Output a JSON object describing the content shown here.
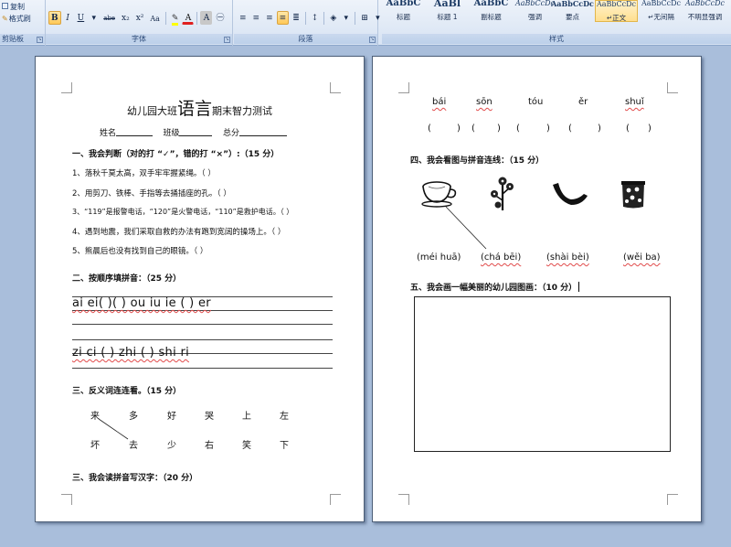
{
  "clipboard": {
    "copy": "复制",
    "format_painter": "格式刷",
    "label": "剪贴板"
  },
  "font": {
    "label": "字体",
    "buttons": [
      "B",
      "I",
      "U",
      "abe",
      "x₂",
      "x²",
      "Aa",
      "A",
      "A",
      "㊀"
    ]
  },
  "paragraph": {
    "label": "段落"
  },
  "styles": {
    "label": "样式",
    "items": [
      {
        "preview": "AaBbC",
        "name": "标题"
      },
      {
        "preview": "AaBl",
        "name": "标题 1"
      },
      {
        "preview": "AaBbC",
        "name": "副标题"
      },
      {
        "preview": "AaBbCcDc",
        "name": "强调"
      },
      {
        "preview": "AaBbCcDc",
        "name": "要点"
      },
      {
        "preview": "AaBbCcDc",
        "name": "正文"
      },
      {
        "preview": "AaBbCcDc",
        "name": "无间隔"
      },
      {
        "preview": "AaBbCcDc",
        "name": "不明显强调"
      }
    ],
    "selected": 5
  },
  "page1": {
    "title_pre": "幼儿园大班",
    "title_big": "语言",
    "title_post": "期末智力测试",
    "fields": [
      "姓名",
      "班级",
      "总分"
    ],
    "s1": {
      "heading": "一、我会判断（对的打 “✓”，错的打 “×”）:（15 分）",
      "items": [
        "1、落秋千莫太高，双手牢牢握紧绳。（     ）",
        "2、用剪刀、铁棒、手指等去捅插座的孔。（     ）",
        "3、“119”是报警电话，“120”是火警电话，“110”是救护电话。（     ）",
        "4、遇到地震，我们采取自救的办法有跑到宽阔的操场上。（     ）",
        "5、熊晨后也没有找到自己的眼镜。（     ）"
      ]
    },
    "s2": {
      "heading": "二、按顺序填拼音：（25 分）",
      "row1": "ai  ei(    )(    )  ou  iu   ie  (   )  er",
      "row2": "zi  ci  (   )  zhi  (   )  shi    ri"
    },
    "s3": {
      "heading": "三、反义词连连看。（15 分）",
      "top": [
        "来",
        "多",
        "好",
        "哭",
        "上",
        "左"
      ],
      "bottom": [
        "坏",
        "去",
        "少",
        "右",
        "笑",
        "下"
      ]
    },
    "s4": {
      "heading": "三、我会读拼音写汉字：（20 分）"
    }
  },
  "page2": {
    "pinyin": [
      "bái",
      "sōn",
      "tóu",
      "ěr",
      "shuǐ"
    ],
    "parens": [
      "(",
      ")",
      "(",
      ")",
      "(",
      ")",
      "(",
      ")",
      "(",
      ")"
    ],
    "s4": {
      "heading": "四、我会看图与拼音连线：（15 分）",
      "labels": [
        "(méi huā)",
        "(chá bēi)",
        "(shài bèi)",
        "(wěi ba)"
      ],
      "icons": [
        "teacup-icon",
        "plum-blossom-icon",
        "tail-icon",
        "quilt-icon"
      ]
    },
    "s5": {
      "heading": "五、我会画一幅美丽的幼儿园图画：（10 分）"
    }
  }
}
